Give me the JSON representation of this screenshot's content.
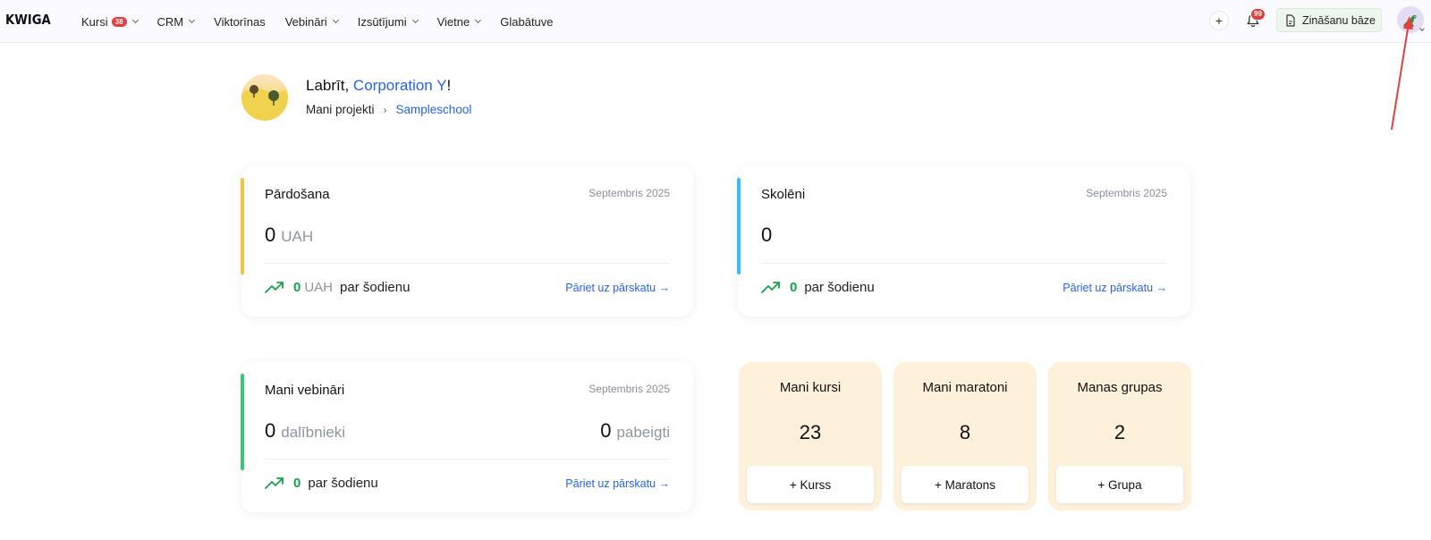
{
  "nav": {
    "logo": "KWIGA",
    "items": [
      {
        "label": "Kursi",
        "badge": "38",
        "dropdown": true
      },
      {
        "label": "CRM",
        "dropdown": true
      },
      {
        "label": "Viktorīnas",
        "dropdown": false
      },
      {
        "label": "Vebināri",
        "dropdown": true
      },
      {
        "label": "Izsūtījumi",
        "dropdown": true
      },
      {
        "label": "Vietne",
        "dropdown": true
      },
      {
        "label": "Glabātuve",
        "dropdown": false
      }
    ],
    "plus_label": "+",
    "notifications_count": "99",
    "knowledge_base_label": "Zināšanu bāze"
  },
  "header": {
    "greeting_prefix": "Labrīt, ",
    "user_name": "Corporation Y",
    "greeting_suffix": "!",
    "breadcrumb_root": "Mani projekti",
    "breadcrumb_sep": "›",
    "breadcrumb_current": "Sampleschool"
  },
  "cards": {
    "sales": {
      "title": "Pārdošana",
      "period": "Septembris 2025",
      "value": "0",
      "unit": "UAH",
      "today_value": "0",
      "today_unit": "UAH",
      "today_label": "par šodienu",
      "link": "Pāriet uz pārskatu →",
      "accent": "#f6c23e"
    },
    "students": {
      "title": "Skolēni",
      "period": "Septembris 2025",
      "value": "0",
      "today_value": "0",
      "today_label": "par šodienu",
      "link": "Pāriet uz pārskatu →",
      "accent": "#38bdf8"
    },
    "webinars": {
      "title": "Mani vebināri",
      "period": "Septembris 2025",
      "value": "0",
      "unit": "dalībnieki",
      "value2": "0",
      "unit2": "pabeigti",
      "today_value": "0",
      "today_label": "par šodienu",
      "link": "Pāriet uz pārskatu →",
      "accent": "#3cc774"
    }
  },
  "tiles": [
    {
      "title": "Mani kursi",
      "value": "23",
      "button": "+ Kurss"
    },
    {
      "title": "Mani maratoni",
      "value": "8",
      "button": "+ Maratons"
    },
    {
      "title": "Manas grupas",
      "value": "2",
      "button": "+ Grupa"
    }
  ],
  "colors": {
    "link": "#2563eb",
    "positive": "#16a34a",
    "tile_bg": "#fdf1db",
    "annotation_arrow": "#e53e3e"
  }
}
